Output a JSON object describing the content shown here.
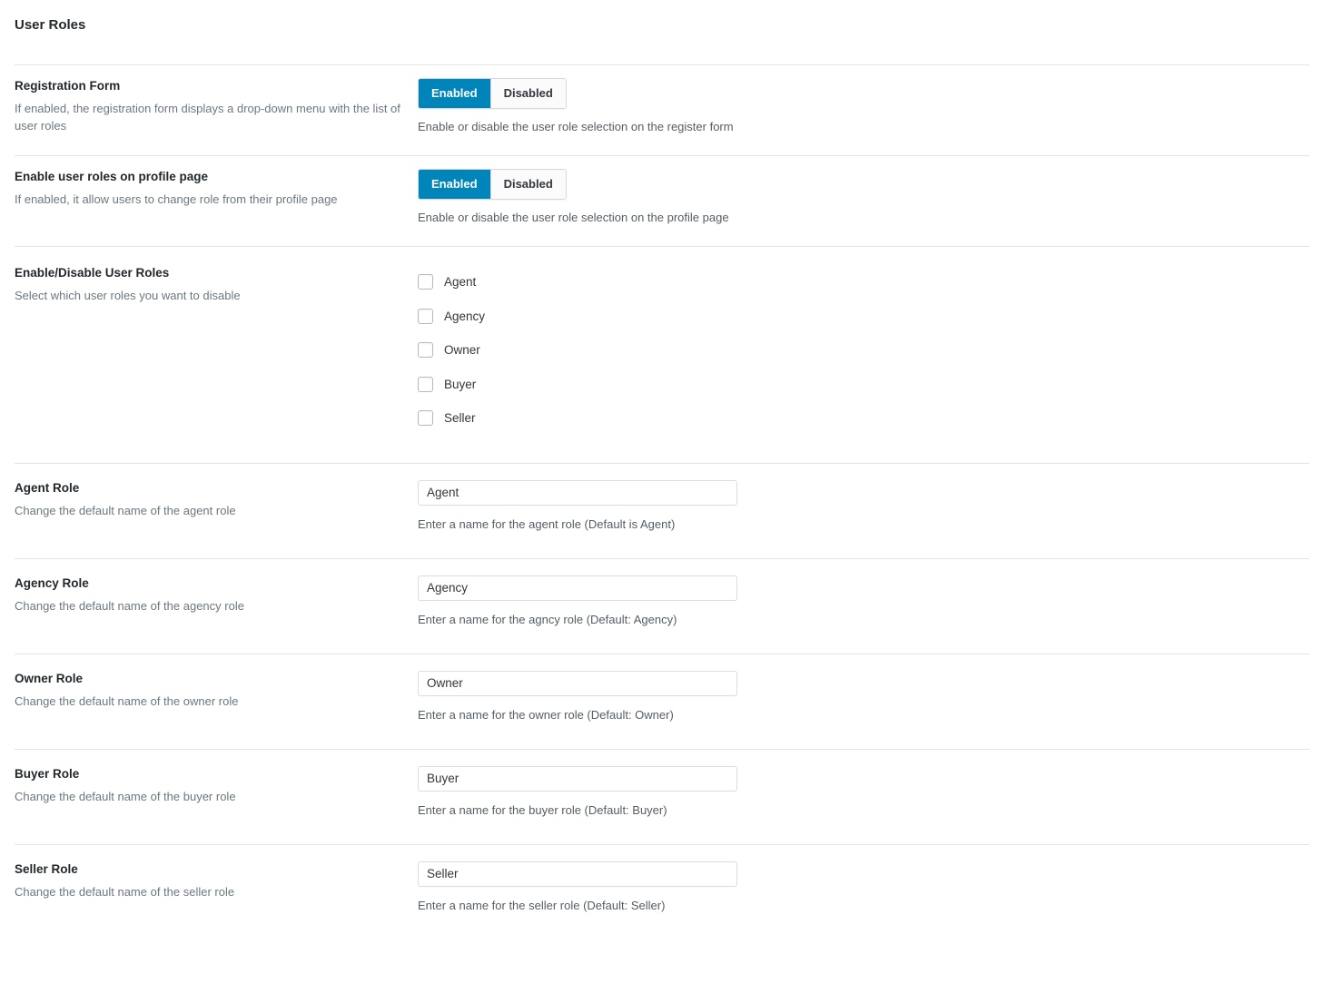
{
  "page": {
    "title": "User Roles"
  },
  "toggle_options": {
    "enabled_label": "Enabled",
    "disabled_label": "Disabled"
  },
  "accent_color": "#0085ba",
  "sections": [
    {
      "id": "registration-form",
      "type": "toggle",
      "label": "Registration Form",
      "description": "If enabled, the registration form displays a drop-down menu with the list of user roles",
      "enabled_label": "Enabled",
      "disabled_label": "Disabled",
      "selected": "Enabled",
      "help": "Enable or disable the user role selection on the register form"
    },
    {
      "id": "profile-page-roles",
      "type": "toggle",
      "label": "Enable user roles on profile page",
      "description": "If enabled, it allow users to change role from their profile page",
      "enabled_label": "Enabled",
      "disabled_label": "Disabled",
      "selected": "Enabled",
      "help": "Enable or disable the user role selection on the profile page"
    },
    {
      "id": "enable-disable-user-roles",
      "type": "checkboxes",
      "label": "Enable/Disable User Roles",
      "description": "Select which user roles you want to disable",
      "options": [
        {
          "label": "Agent",
          "checked": false
        },
        {
          "label": "Agency",
          "checked": false
        },
        {
          "label": "Owner",
          "checked": false
        },
        {
          "label": "Buyer",
          "checked": false
        },
        {
          "label": "Seller",
          "checked": false
        }
      ]
    },
    {
      "id": "agent-role",
      "type": "text",
      "label": "Agent Role",
      "description": "Change the default name of the agent role",
      "value": "Agent",
      "help": "Enter a name for the agent role (Default is Agent)"
    },
    {
      "id": "agency-role",
      "type": "text",
      "label": "Agency Role",
      "description": "Change the default name of the agency role",
      "value": "Agency",
      "help": "Enter a name for the agncy role (Default: Agency)"
    },
    {
      "id": "owner-role",
      "type": "text",
      "label": "Owner Role",
      "description": "Change the default name of the owner role",
      "value": "Owner",
      "help": "Enter a name for the owner role (Default: Owner)"
    },
    {
      "id": "buyer-role",
      "type": "text",
      "label": "Buyer Role",
      "description": "Change the default name of the buyer role",
      "value": "Buyer",
      "help": "Enter a name for the buyer role (Default: Buyer)"
    },
    {
      "id": "seller-role",
      "type": "text",
      "label": "Seller Role",
      "description": "Change the default name of the seller role",
      "value": "Seller",
      "help": "Enter a name for the seller role (Default: Seller)"
    }
  ]
}
